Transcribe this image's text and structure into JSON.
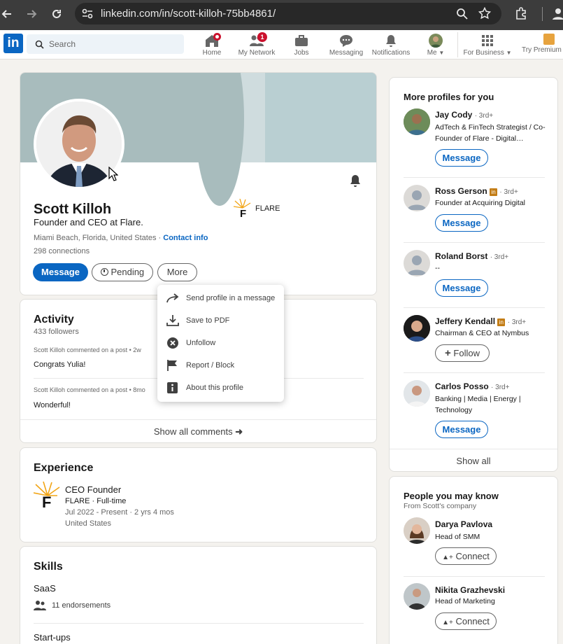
{
  "browser": {
    "url": "linkedin.com/in/scott-killoh-75bb4861/"
  },
  "header": {
    "search_placeholder": "Search",
    "nav": [
      {
        "label": "Home",
        "badge": ""
      },
      {
        "label": "My Network",
        "badge": "1"
      },
      {
        "label": "Jobs",
        "badge": ""
      },
      {
        "label": "Messaging",
        "badge": ""
      },
      {
        "label": "Notifications",
        "badge": ""
      },
      {
        "label": "Me",
        "badge": ""
      },
      {
        "label": "For Business",
        "badge": ""
      },
      {
        "label": "Try Premium f",
        "badge": ""
      }
    ]
  },
  "profile": {
    "name": "Scott Killoh",
    "headline": "Founder and CEO at Flare.",
    "location": "Miami Beach, Florida, United States",
    "separator": "·",
    "contact_link": "Contact info",
    "connections": "298 connections",
    "company": "FLARE",
    "buttons": {
      "message": "Message",
      "pending": "Pending",
      "more": "More"
    }
  },
  "more_menu": {
    "items": [
      "Send profile in a message",
      "Save to PDF",
      "Unfollow",
      "Report / Block",
      "About this profile"
    ]
  },
  "activity": {
    "title": "Activity",
    "followers": "433 followers",
    "posts": [
      {
        "author": "Scott Killoh",
        "meta": " commented on a post • 2w",
        "text": "Congrats Yulia!"
      },
      {
        "author": "Scott Killoh",
        "meta": " commented on a post • 8mo",
        "text": "Wonderful!"
      }
    ],
    "show_all": "Show all comments"
  },
  "experience": {
    "title": "Experience",
    "role": "CEO Founder",
    "company": "FLARE · Full-time",
    "dates": "Jul 2022 - Present · 2 yrs 4 mos",
    "location": "United States"
  },
  "skills": {
    "title": "Skills",
    "items": [
      {
        "name": "SaaS",
        "endorsements": "11 endorsements"
      },
      {
        "name": "Start-ups"
      }
    ]
  },
  "more_profiles": {
    "title": "More profiles for you",
    "people": [
      {
        "name": "Jay Cody",
        "degree": "· 3rd+",
        "premium": false,
        "headline": "AdTech & FinTech Strategist / Co-Founder of Flare - Digital…",
        "action": "Message"
      },
      {
        "name": "Ross Gerson",
        "degree": "· 3rd+",
        "premium": true,
        "headline": "Founder at Acquiring Digital",
        "action": "Message"
      },
      {
        "name": "Roland Borst",
        "degree": "· 3rd+",
        "premium": false,
        "headline": "--",
        "action": "Message"
      },
      {
        "name": "Jeffery Kendall",
        "degree": "· 3rd+",
        "premium": true,
        "headline": "Chairman & CEO at Nymbus",
        "action": "Follow"
      },
      {
        "name": "Carlos Posso",
        "degree": "· 3rd+",
        "premium": false,
        "headline": "Banking | Media | Energy | Technology",
        "action": "Message"
      }
    ],
    "show_all": "Show all"
  },
  "people_may_know": {
    "title": "People you may know",
    "subtitle": "From Scott's company",
    "people": [
      {
        "name": "Darya Pavlova",
        "headline": "Head of SMM",
        "action": "Connect"
      },
      {
        "name": "Nikita Grazhevski",
        "headline": "Head of Marketing",
        "action": "Connect"
      }
    ]
  },
  "colors": {
    "brand": "#0a66c2",
    "badge": "#cb112d",
    "banner": "#a8bcbd"
  }
}
